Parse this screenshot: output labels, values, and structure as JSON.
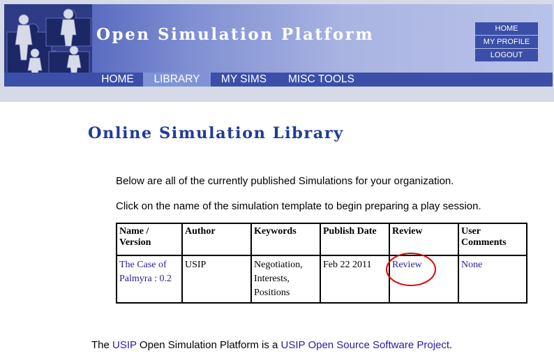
{
  "header": {
    "title": "Open Simulation Platform",
    "user_menu": [
      "HOME",
      "MY PROFILE",
      "LOGOUT"
    ],
    "nav": [
      {
        "label": "HOME",
        "active": false
      },
      {
        "label": "LIBRARY",
        "active": true
      },
      {
        "label": "MY SIMS",
        "active": false
      },
      {
        "label": "MISC TOOLS",
        "active": false
      }
    ],
    "logo_icon": "puzzle-people-icon"
  },
  "main": {
    "title": "Online Simulation Library",
    "intro1": "Below are all of the currently published Simulations for your organization.",
    "intro2": "Click on the name of the simulation template to begin preparing a play session.",
    "table": {
      "headers": {
        "name_line1": "Name /",
        "name_line2": "Version",
        "author": "Author",
        "keywords": "Keywords",
        "publish_date": "Publish Date",
        "review": "Review",
        "comments_line1": "User",
        "comments_line2": "Comments"
      },
      "rows": [
        {
          "name_line1": "The Case of",
          "name_line2": "Palmyra : 0.2",
          "author": "USIP",
          "keywords": [
            "Negotiation,",
            "Interests,",
            "Positions"
          ],
          "publish_date": "Feb 22 2011",
          "review": "Review",
          "comments": "None"
        }
      ]
    }
  },
  "footer": {
    "text1": "The ",
    "link1": "USIP",
    "text2": " Open Simulation Platform is a ",
    "link2": "USIP Open Source Software Project",
    "text3": "."
  },
  "colors": {
    "nav_bar": "#3b4fa8",
    "nav_active": "#7f93d6",
    "title_blue": "#1f3b99",
    "link": "#2b1aa0",
    "highlight_circle": "#e00000"
  }
}
